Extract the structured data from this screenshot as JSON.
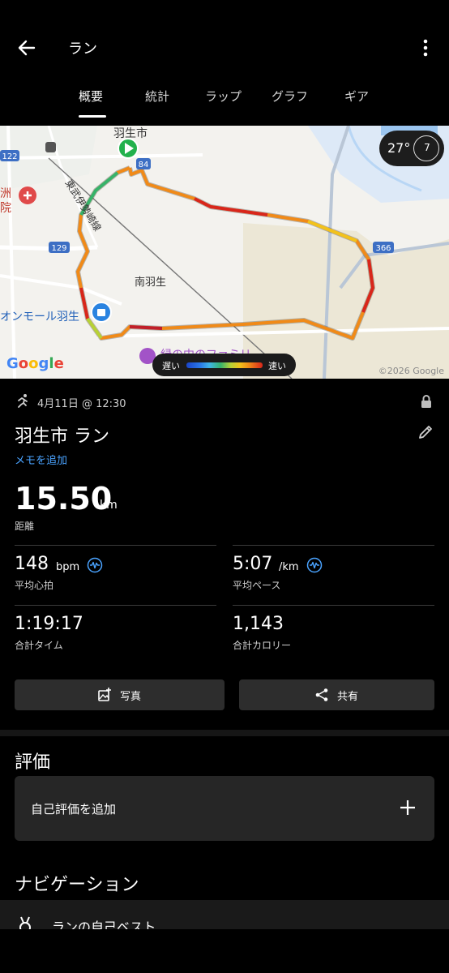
{
  "header": {
    "title": "ラン",
    "tabs": [
      {
        "label": "概要",
        "active": true
      },
      {
        "label": "統計",
        "active": false
      },
      {
        "label": "ラップ",
        "active": false
      },
      {
        "label": "グラフ",
        "active": false
      },
      {
        "label": "ギア",
        "active": false
      }
    ]
  },
  "map": {
    "labels": {
      "start_city": "羽生市",
      "road_84": "84",
      "road_122": "122",
      "road_129": "129",
      "road_366": "366",
      "rail_line": "東武伊勢崎線",
      "station": "南羽生",
      "mall": "オンモール羽生",
      "hospital_partial": "洲",
      "hospital_partial2": "院",
      "poi_partial": "緑の中のファミリ"
    },
    "weather": {
      "temp": "27°",
      "wind": "7"
    },
    "legend": {
      "slow": "遅い",
      "fast": "速い"
    },
    "logo": "Google",
    "copyright": "©2026 Google",
    "colors": {
      "route_slow": "#d8261b",
      "route_fast": "#36b36b",
      "route_mid": "#f2a21b"
    }
  },
  "activity": {
    "date": "4月11日 @ 12:30",
    "title": "羽生市 ラン",
    "memo_link": "メモを追加",
    "distance": {
      "value": "15.50",
      "unit": "km",
      "label": "距離"
    },
    "stats": {
      "heart_rate": {
        "value": "148",
        "unit": "bpm",
        "label": "平均心拍"
      },
      "pace": {
        "value": "5:07",
        "unit": "/km",
        "label": "平均ペース"
      },
      "time": {
        "value": "1:19:17",
        "label": "合計タイム"
      },
      "calories": {
        "value": "1,143",
        "label": "合計カロリー"
      }
    },
    "buttons": {
      "photo": "写真",
      "share": "共有"
    }
  },
  "evaluation": {
    "section_title": "評価",
    "card_label": "自己評価を追加"
  },
  "navigation": {
    "section_title": "ナビゲーション",
    "first_item": "ランの自己ベスト"
  },
  "accent_color": "#4aa3ff"
}
